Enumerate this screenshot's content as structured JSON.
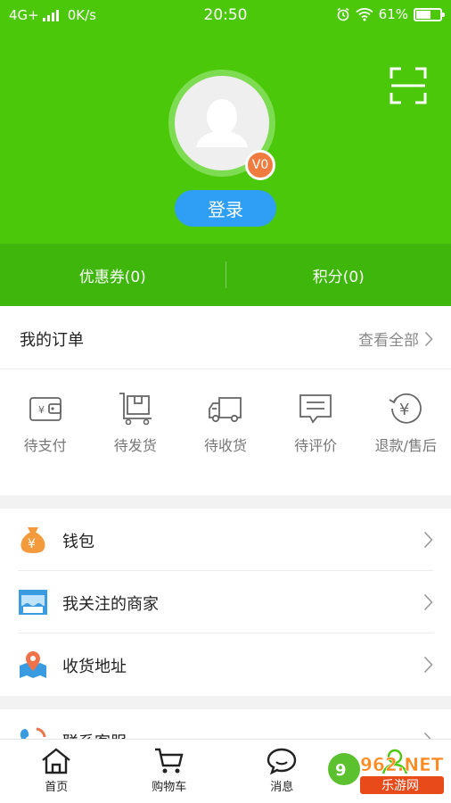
{
  "status_bar": {
    "network": "4G+",
    "speed": "0K/s",
    "time": "20:50",
    "battery_percent": "61%",
    "battery_level": 0.61
  },
  "profile": {
    "vip_level": "V0",
    "login_label": "登录"
  },
  "stats": {
    "coupons": "优惠券(0)",
    "points": "积分(0)"
  },
  "orders": {
    "title": "我的订单",
    "view_all": "查看全部",
    "items": [
      {
        "label": "待支付",
        "icon": "wallet-icon"
      },
      {
        "label": "待发货",
        "icon": "package-icon"
      },
      {
        "label": "待收货",
        "icon": "truck-icon"
      },
      {
        "label": "待评价",
        "icon": "comment-icon"
      },
      {
        "label": "退款/售后",
        "icon": "refund-icon"
      }
    ]
  },
  "menu": {
    "items": [
      {
        "label": "钱包",
        "icon": "money-bag-icon"
      },
      {
        "label": "我关注的商家",
        "icon": "store-icon"
      },
      {
        "label": "收货地址",
        "icon": "location-map-icon"
      }
    ],
    "partial_item": {
      "label": "联系客服",
      "icon": "phone-icon"
    }
  },
  "tabbar": {
    "items": [
      {
        "label": "首页",
        "icon": "home-icon"
      },
      {
        "label": "购物车",
        "icon": "cart-icon"
      },
      {
        "label": "消息",
        "icon": "message-icon"
      }
    ]
  },
  "watermark": {
    "brand": "962.NET",
    "subtitle": "乐游网"
  },
  "colors": {
    "header_green": "#4bc809",
    "stats_green": "#3fb60b",
    "login_blue": "#2f9ff6",
    "vip_orange": "#f07b3f"
  }
}
